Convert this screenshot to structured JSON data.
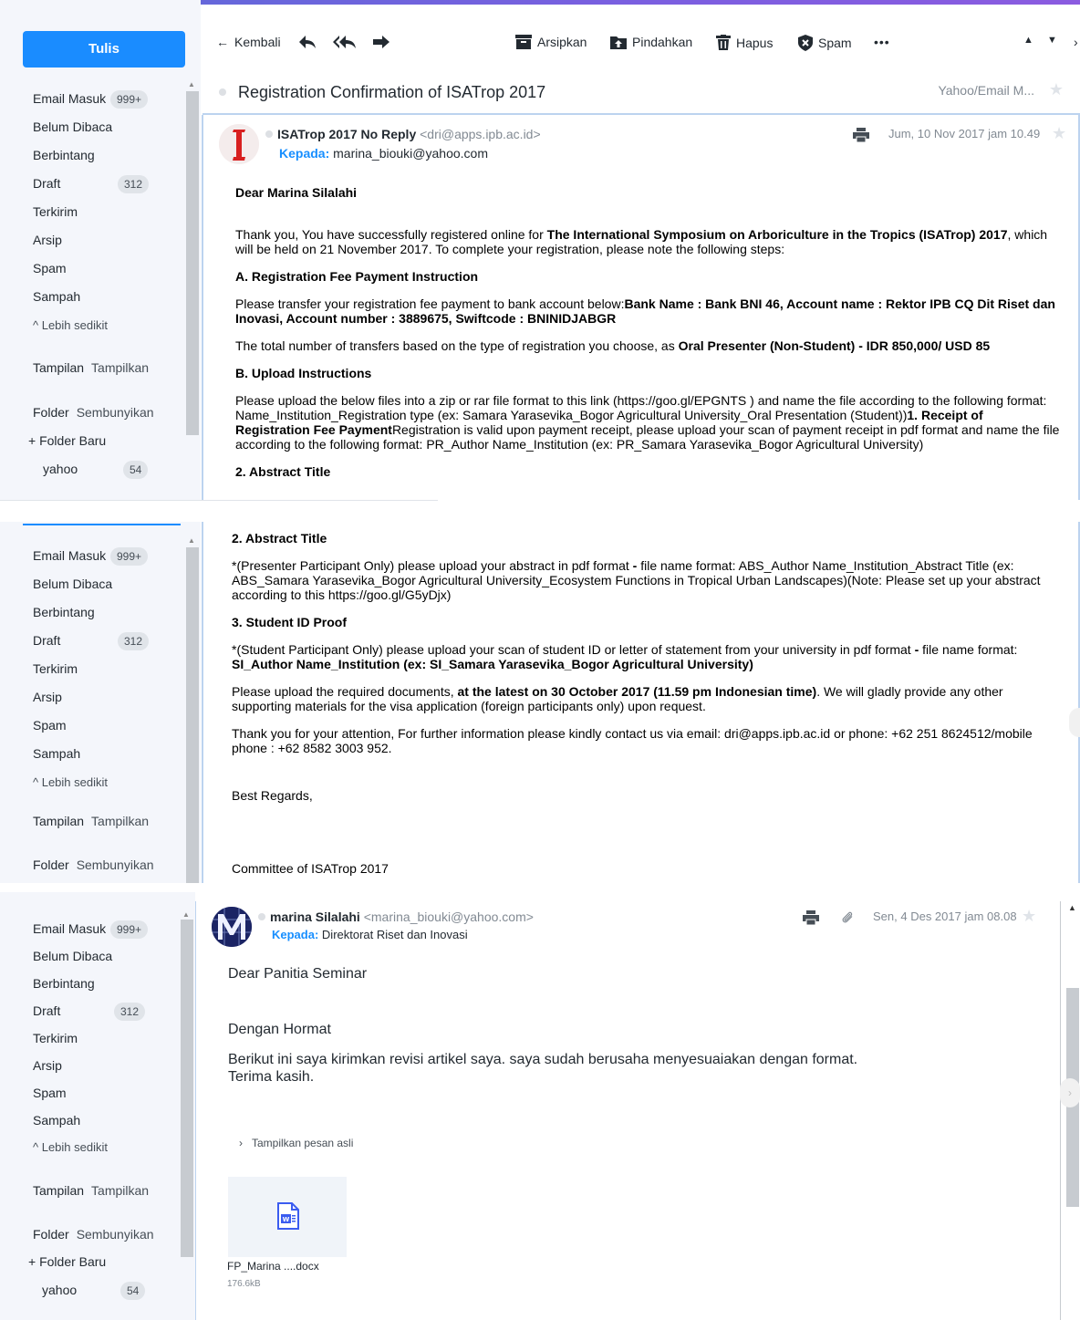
{
  "sidebar": {
    "compose_label": "Tulis",
    "inbox": "Email Masuk",
    "inbox_count": "999+",
    "unread": "Belum Dibaca",
    "starred": "Berbintang",
    "drafts": "Draft",
    "drafts_count": "312",
    "sent": "Terkirim",
    "archive": "Arsip",
    "spam": "Spam",
    "trash": "Sampah",
    "less": "Lebih sedikit",
    "views_label": "Tampilan",
    "views_action": "Tampilkan",
    "folders_label": "Folder",
    "folders_action": "Sembunyikan",
    "new_folder": "Folder Baru",
    "custom_folder": "yahoo",
    "custom_folder_count": "54"
  },
  "toolbar": {
    "back": "Kembali",
    "archive": "Arsipkan",
    "move": "Pindahkan",
    "delete": "Hapus",
    "spam": "Spam",
    "more": "•••"
  },
  "thread": {
    "subject": "Registration Confirmation of ISATrop 2017",
    "folder_tag": "Yahoo/Email M..."
  },
  "message1": {
    "from_name": "ISATrop 2017 No Reply",
    "from_email": "<dri@apps.ipb.ac.id>",
    "to_label": "Kepada:",
    "to": "marina_biouki@yahoo.com",
    "date": "Jum, 10 Nov 2017 jam 10.49",
    "greeting": "Dear Marina Silalahi",
    "intro_a": "Thank you, You have successfully registered online for ",
    "intro_b": "The International Symposium on Arboriculture in the Tropics (ISATrop) 2017",
    "intro_c": ", which will be held on 21 November 2017. To complete your registration, please note the following steps:",
    "sec_a": "A. Registration Fee Payment Instruction",
    "pay_a": "Please transfer your registration fee payment to bank account below:",
    "pay_b": "Bank Name : Bank BNI 46, Account name : Rektor IPB CQ Dit Riset dan Inovasi, Account number : 3889675, Swiftcode : BNINIDJABGR",
    "total_a": "The total number of transfers based on the type of registration you choose, as ",
    "total_b": "Oral Presenter (Non-Student) - IDR 850,000/ USD 85",
    "sec_b": "B. Upload Instructions",
    "upload_a": "Please upload the below files into a zip or rar file format to this link (https://goo.gl/EPGNTS ) and name the file according to the following format: Name_Institution_Registration type (ex: Samara Yarasevika_Bogor Agricultural University_Oral Presentation (Student))",
    "upload_b": "1. Receipt of Registration Fee Payment",
    "upload_c": "Registration is valid upon payment receipt, please upload your scan of payment receipt in pdf format and name the file according to the following format: PR_Author Name_Institution (ex: PR_Samara Yarasevika_Bogor Agricultural University)",
    "sec_2": "2. Abstract Title",
    "abstract_a": "*(Presenter Participant Only) please upload your abstract in pdf format ",
    "abstract_b": "- ",
    "abstract_c": "file name format: ABS_Author Name_Institution_Abstract Title (ex: ABS_Samara Yarasevika_Bogor Agricultural University_Ecosystem Functions in Tropical Urban Landscapes)(Note: Please set up your abstract according to this https://goo.gl/G5yDjx)",
    "sec_3": "3. Student ID Proof",
    "student_a": "*(Student Participant Only) please upload your scan of student ID or letter of statement from your university in pdf format ",
    "student_b": "- ",
    "student_c": "file name format: ",
    "student_d": "SI_Author Name_Institution (ex: SI_Samara Yarasevika_Bogor Agricultural University)",
    "deadline_a": "Please upload the required documents, ",
    "deadline_b": "at the latest on 30 October 2017 (11.59 pm Indonesian time)",
    "deadline_c": ". We will gladly provide any other supporting materials for the visa application (foreign participants only) upon request.",
    "contact": "Thank you for your attention, For further information please kindly contact us via email: dri@apps.ipb.ac.id or phone: +62 251 8624512/mobile phone : +62 8582 3003 952.",
    "regards": "Best Regards,",
    "signature": "Committee of ISATrop 2017"
  },
  "message2": {
    "from_name": "marina Silalahi",
    "from_email": "<marina_biouki@yahoo.com>",
    "to_label": "Kepada:",
    "to": "Direktorat Riset dan Inovasi",
    "date": "Sen, 4 Des 2017 jam 08.08",
    "line1": "Dear Panitia Seminar",
    "line2": "Dengan Hormat",
    "line3": "Berikut ini saya kirimkan revisi artikel saya. saya sudah berusaha menyesuaiakan dengan format.",
    "line4": "Terima kasih.",
    "show_original": "Tampilkan pesan asli",
    "attachment_name": "FP_Marina ....docx",
    "attachment_size": "176.6kB"
  },
  "colors": {
    "accent": "#1a8cff",
    "sidebar_bg": "#f4f6fb",
    "link_blue": "#188fff"
  }
}
